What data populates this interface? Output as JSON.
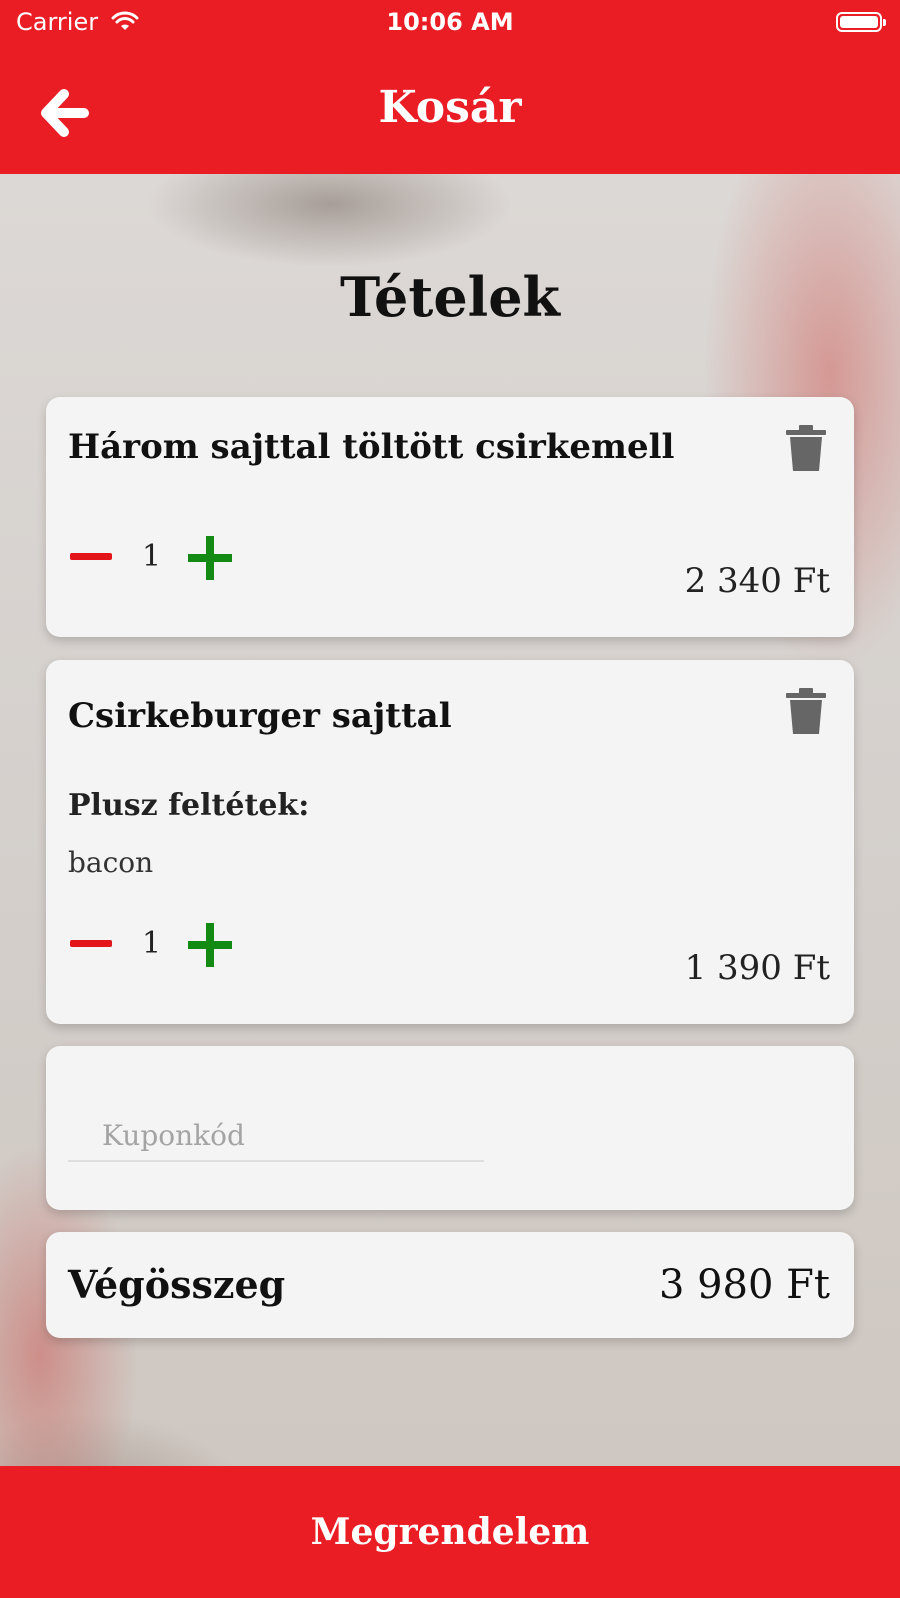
{
  "status_bar": {
    "carrier": "Carrier",
    "time": "10:06 AM"
  },
  "nav": {
    "title": "Kosár",
    "back_icon": "arrow-left-icon"
  },
  "section_title": "Tételek",
  "items": [
    {
      "name": "Három sajttal töltött csirkemell",
      "quantity": "1",
      "price": "2 340 Ft"
    },
    {
      "name": "Csirkeburger sajttal",
      "extras_label": "Plusz feltétek:",
      "extras": "bacon",
      "quantity": "1",
      "price": "1 390 Ft"
    }
  ],
  "coupon": {
    "placeholder": "Kuponkód",
    "value": ""
  },
  "total": {
    "label": "Végösszeg",
    "value": "3 980 Ft"
  },
  "order_button": {
    "label": "Megrendelem"
  },
  "colors": {
    "brand_red": "#ea1d25",
    "minus_red": "#e4141b",
    "plus_green": "#138a14",
    "card": "#f4f4f4",
    "trash": "#666666"
  }
}
